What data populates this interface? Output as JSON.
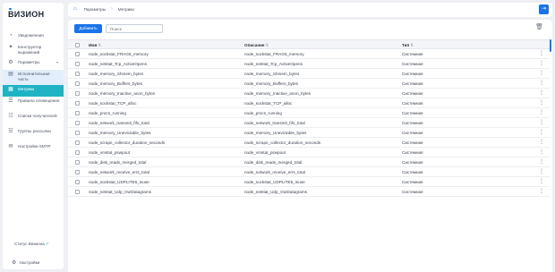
{
  "app": {
    "logo": "ВИЗИОН"
  },
  "sidebar": {
    "items": [
      {
        "icon": "notification-icon",
        "glyph": "◔",
        "label": "Уведомления",
        "cls": ""
      },
      {
        "icon": "builder-icon",
        "glyph": "✦",
        "label": "Конструктор выражений",
        "cls": ""
      },
      {
        "icon": "parameters-icon",
        "glyph": "⚙",
        "label": "Параметры",
        "cls": "",
        "chevron": "▾"
      },
      {
        "icon": "exec-part-icon",
        "glyph": "▤",
        "label": "Исполнительная часть",
        "cls": "active"
      },
      {
        "icon": "metrics-icon",
        "glyph": "▦",
        "label": "Метрики",
        "cls": "active-main"
      },
      {
        "icon": "alert-rules-icon",
        "glyph": "☰",
        "label": "Правила оповещения",
        "cls": ""
      },
      {
        "icon": "recipients-icon",
        "glyph": "☷",
        "label": "Списки получателей",
        "cls": ""
      },
      {
        "icon": "mailing-groups-icon",
        "glyph": "☱",
        "label": "Группы рассылки",
        "cls": ""
      },
      {
        "icon": "smtp-settings-icon",
        "glyph": "✉",
        "label": "Настройки SMTP",
        "cls": ""
      }
    ],
    "status_label": "Статус Визиона",
    "status_icon": "✓",
    "settings_label": "Настройки"
  },
  "breadcrumb": {
    "items": [
      "Параметры",
      "Метрики"
    ]
  },
  "toolbar": {
    "add_label": "Добавить",
    "search_placeholder": "Поиск"
  },
  "table": {
    "headers": {
      "name": "Имя",
      "description": "Описание",
      "type": "Тип",
      "sort_icon": "⇅"
    },
    "rows": [
      {
        "name": "node_sockstat_FRAG6_memory",
        "description": "node_sockstat_FRAG6_memory",
        "type": "Системная"
      },
      {
        "name": "node_netstat_Tcp_ActiveOpens",
        "description": "node_netstat_Tcp_ActiveOpens",
        "type": "Системная"
      },
      {
        "name": "node_memory_Shmem_bytes",
        "description": "node_memory_Shmem_bytes",
        "type": "Системная"
      },
      {
        "name": "node_memory_Buffers_bytes",
        "description": "node_memory_Buffers_bytes",
        "type": "Системная"
      },
      {
        "name": "node_memory_Inactive_anon_bytes",
        "description": "node_memory_Inactive_anon_bytes",
        "type": "Системная"
      },
      {
        "name": "node_sockstat_TCP_alloc",
        "description": "node_sockstat_TCP_alloc",
        "type": "Системная"
      },
      {
        "name": "node_procs_running",
        "description": "node_procs_running",
        "type": "Системная"
      },
      {
        "name": "node_network_transmit_fifo_total",
        "description": "node_network_transmit_fifo_total",
        "type": "Системная"
      },
      {
        "name": "node_memory_Unevictable_bytes",
        "description": "node_memory_Unevictable_bytes",
        "type": "Системная"
      },
      {
        "name": "node_scrape_collector_duration_seconds",
        "description": "node_scrape_collector_duration_seconds",
        "type": "Системная"
      },
      {
        "name": "node_vmstat_pswpout",
        "description": "node_vmstat_pswpout",
        "type": "Системная"
      },
      {
        "name": "node_disk_reads_merged_total",
        "description": "node_disk_reads_merged_total",
        "type": "Системная"
      },
      {
        "name": "node_network_receive_errs_total",
        "description": "node_network_receive_errs_total",
        "type": "Системная"
      },
      {
        "name": "node_sockstat_UDPLITE6_inuse",
        "description": "node_sockstat_UDPLITE6_inuse",
        "type": "Системная"
      },
      {
        "name": "node_netstat_Udp_OutDatagrams",
        "description": "node_netstat_Udp_OutDatagrams",
        "type": "Системная"
      }
    ]
  },
  "icons": {
    "home": "⌂",
    "crumb_separator": "›",
    "logout": "⇥",
    "trash": "🗑",
    "kebab": "⋮",
    "settings": "⚙"
  }
}
